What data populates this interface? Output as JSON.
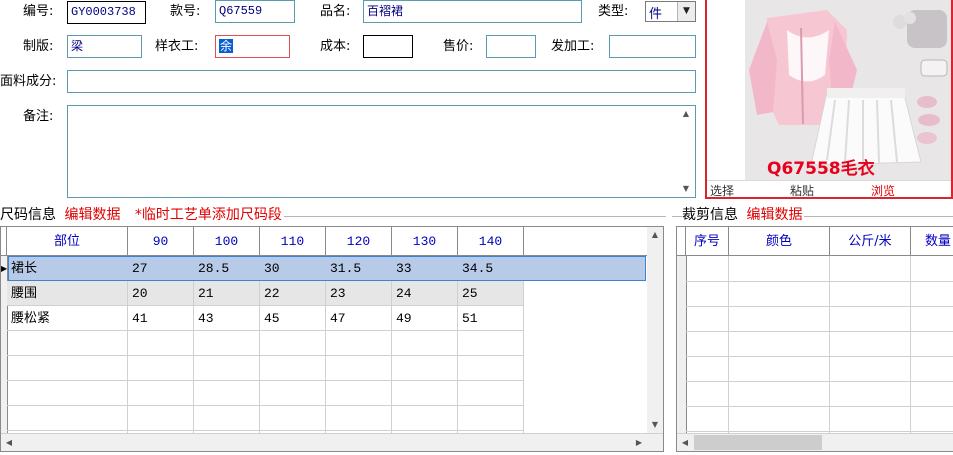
{
  "form": {
    "code_label": "编号:",
    "code_value": "GY0003738",
    "style_label": "款号:",
    "style_value": "Q67559",
    "name_label": "品名:",
    "name_value": "百褶裙",
    "type_label": "类型:",
    "type_value": "件",
    "pattern_label": "制版:",
    "pattern_value": "梁",
    "sample_label": "样衣工:",
    "sample_value": "余",
    "cost_label": "成本:",
    "cost_value": "",
    "price_label": "售价:",
    "price_value": "",
    "outsource_label": "发加工:",
    "outsource_value": "",
    "fabric_label": "面料成分:",
    "fabric_value": "",
    "notes_label": "备注:",
    "notes_value": ""
  },
  "image_panel": {
    "overlay_text": "Q67558毛衣",
    "select_label": "选择",
    "paste_label": "粘贴",
    "browse_label": "浏览",
    "colors": {
      "overlay": "#e8001c",
      "border": "#d9262e"
    }
  },
  "size_section": {
    "title": "尺码信息",
    "edit_link": "编辑数据",
    "note": "*临时工艺单添加尺码段",
    "columns": [
      "部位",
      "90",
      "100",
      "110",
      "120",
      "130",
      "140"
    ],
    "rows": [
      [
        "裙长",
        "27",
        "28.5",
        "30",
        "31.5",
        "33",
        "34.5"
      ],
      [
        "腰围",
        "20",
        "21",
        "22",
        "23",
        "24",
        "25"
      ],
      [
        "腰松紧",
        "41",
        "43",
        "45",
        "47",
        "49",
        "51"
      ]
    ]
  },
  "cut_section": {
    "title": "裁剪信息",
    "edit_link": "编辑数据",
    "columns": [
      "序号",
      "颜色",
      "公斤/米",
      "数量"
    ]
  },
  "colors": {
    "accent_red": "#e00000",
    "header_blue": "#0000c0",
    "selected_row": "#b7cbe9",
    "alt_row": "#e6e6e6"
  }
}
